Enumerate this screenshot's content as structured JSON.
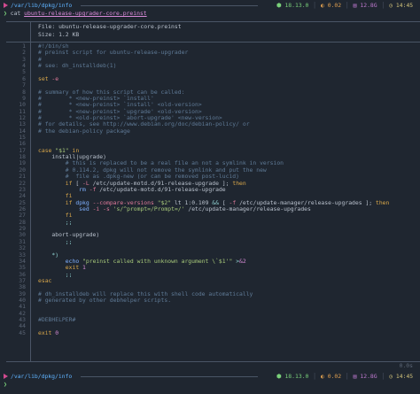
{
  "prompt_top": {
    "path": "/var/lib/dpkg/info",
    "command": "cat",
    "argument": "ubuntu-release-upgrader-core.preinst",
    "stats": {
      "node": "18.13.0",
      "cpu": "0.02",
      "mem": "12.8G",
      "time": "14:45"
    }
  },
  "bat": {
    "file_label": "File: ubuntu-release-upgrader-core.preinst",
    "size_label": "Size: 1.2 KB"
  },
  "code_lines": [
    [
      [
        "c-com",
        "#!/bin/sh"
      ]
    ],
    [
      [
        "c-com",
        "# preinst script for ubuntu-release-upgrader"
      ]
    ],
    [
      [
        "c-com",
        "#"
      ]
    ],
    [
      [
        "c-com",
        "# see: dh_installdeb(1)"
      ]
    ],
    [],
    [
      [
        "c-kw",
        "set"
      ],
      [
        "c-pl",
        " "
      ],
      [
        "c-var",
        "-e"
      ]
    ],
    [],
    [
      [
        "c-com",
        "# summary of how this script can be called:"
      ]
    ],
    [
      [
        "c-com",
        "#        * <new-preinst> `install'"
      ]
    ],
    [
      [
        "c-com",
        "#        * <new-preinst> `install' <old-version>"
      ]
    ],
    [
      [
        "c-com",
        "#        * <new-preinst> `upgrade' <old-version>"
      ]
    ],
    [
      [
        "c-com",
        "#        * <old-preinst> `abort-upgrade' <new-version>"
      ]
    ],
    [
      [
        "c-com",
        "# for details, see http://www.debian.org/doc/debian-policy/ or"
      ]
    ],
    [
      [
        "c-com",
        "# the debian-policy package"
      ]
    ],
    [],
    [],
    [
      [
        "c-kw",
        "case"
      ],
      [
        "c-pl",
        " "
      ],
      [
        "c-str",
        "\"$1\""
      ],
      [
        "c-pl",
        " "
      ],
      [
        "c-kw",
        "in"
      ]
    ],
    [
      [
        "c-pl",
        "    "
      ],
      [
        "c-pl",
        "install|upgrade)"
      ]
    ],
    [
      [
        "c-com",
        "        # this is replaced to be a real file an not a symlink in version"
      ]
    ],
    [
      [
        "c-com",
        "        # 0.114.2, dpkg will not remove the symlink and put the new"
      ]
    ],
    [
      [
        "c-com",
        "        #  file as .dpkg-new (or can be removed post-lucid)"
      ]
    ],
    [
      [
        "c-pl",
        "        "
      ],
      [
        "c-kw",
        "if"
      ],
      [
        "c-pl",
        " [ "
      ],
      [
        "c-var",
        "-L"
      ],
      [
        "c-pl",
        " /etc/update-motd.d/91-release-upgrade ]; "
      ],
      [
        "c-kw",
        "then"
      ]
    ],
    [
      [
        "c-pl",
        "            "
      ],
      [
        "c-fn",
        "rm"
      ],
      [
        "c-pl",
        " "
      ],
      [
        "c-var",
        "-f"
      ],
      [
        "c-pl",
        " /etc/update-motd.d/91-release-upgrade"
      ]
    ],
    [
      [
        "c-pl",
        "        "
      ],
      [
        "c-kw",
        "fi"
      ]
    ],
    [
      [
        "c-pl",
        "        "
      ],
      [
        "c-kw",
        "if"
      ],
      [
        "c-pl",
        " "
      ],
      [
        "c-fn",
        "dpkg"
      ],
      [
        "c-pl",
        " "
      ],
      [
        "c-var",
        "--compare-versions"
      ],
      [
        "c-pl",
        " "
      ],
      [
        "c-str",
        "\"$2\""
      ],
      [
        "c-pl",
        " lt 1:0.109 "
      ],
      [
        "c-op",
        "&&"
      ],
      [
        "c-pl",
        " [ "
      ],
      [
        "c-var",
        "-f"
      ],
      [
        "c-pl",
        " /etc/update-manager/release-upgrades ]; "
      ],
      [
        "c-kw",
        "then"
      ]
    ],
    [
      [
        "c-pl",
        "            "
      ],
      [
        "c-fn",
        "sed"
      ],
      [
        "c-pl",
        " "
      ],
      [
        "c-var",
        "-i"
      ],
      [
        "c-pl",
        " "
      ],
      [
        "c-var",
        "-s"
      ],
      [
        "c-pl",
        " "
      ],
      [
        "c-str",
        "'s/^prompt=/Prompt=/'"
      ],
      [
        "c-pl",
        " /etc/update-manager/release-upgrades"
      ]
    ],
    [
      [
        "c-pl",
        "        "
      ],
      [
        "c-kw",
        "fi"
      ]
    ],
    [
      [
        "c-pl",
        "        "
      ],
      [
        "c-op",
        ";;"
      ]
    ],
    [],
    [
      [
        "c-pl",
        "    abort-upgrade)"
      ]
    ],
    [
      [
        "c-pl",
        "        "
      ],
      [
        "c-op",
        ";;"
      ]
    ],
    [],
    [
      [
        "c-pl",
        "    "
      ],
      [
        "c-op",
        "*)"
      ]
    ],
    [
      [
        "c-pl",
        "        "
      ],
      [
        "c-fn",
        "echo"
      ],
      [
        "c-pl",
        " "
      ],
      [
        "c-str",
        "\"preinst called with unknown argument \\`$1'\""
      ],
      [
        "c-pl",
        " "
      ],
      [
        "c-op",
        ">"
      ],
      [
        "c-num",
        "&2"
      ]
    ],
    [
      [
        "c-pl",
        "        "
      ],
      [
        "c-kw",
        "exit"
      ],
      [
        "c-pl",
        " "
      ],
      [
        "c-num",
        "1"
      ]
    ],
    [
      [
        "c-pl",
        "        "
      ],
      [
        "c-op",
        ";;"
      ]
    ],
    [
      [
        "c-kw",
        "esac"
      ]
    ],
    [],
    [
      [
        "c-com",
        "# dh_installdeb will replace this with shell code automatically"
      ]
    ],
    [
      [
        "c-com",
        "# generated by other debhelper scripts."
      ]
    ],
    [],
    [],
    [
      [
        "c-com",
        "#DEBHELPER#"
      ]
    ],
    [],
    [
      [
        "c-kw",
        "exit"
      ],
      [
        "c-pl",
        " "
      ],
      [
        "c-num",
        "0"
      ]
    ]
  ],
  "prompt_bottom": {
    "path": "/var/lib/dpkg/info",
    "duration": "0.0s",
    "stats": {
      "node": "18.13.0",
      "cpu": "0.02",
      "mem": "12.8G",
      "time": "14:45"
    }
  }
}
